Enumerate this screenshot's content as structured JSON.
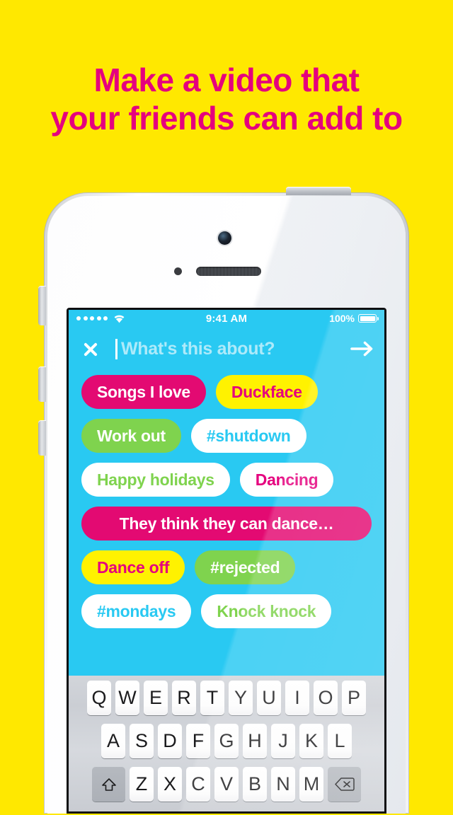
{
  "page": {
    "background_color": "#FFE800",
    "accent_pink": "#E5007E",
    "screen_cyan": "#29C9F2",
    "tag_green": "#7FD34E",
    "tag_yellow": "#FFF200"
  },
  "headline": {
    "line1": "Make a video that",
    "line2": "your friends can add to"
  },
  "phone": {
    "hardware": {
      "camera": "camera-icon",
      "proximity_sensor": "proximity-sensor-icon",
      "speaker": "earpiece-speaker",
      "power_button": "power-button",
      "mute_switch": "mute-switch",
      "volume_up": "volume-up-button",
      "volume_down": "volume-down-button"
    }
  },
  "status_bar": {
    "signal_dots": 5,
    "wifi": "wifi-icon",
    "time": "9:41 AM",
    "battery_percent": "100%",
    "battery_level": 100
  },
  "search": {
    "close_icon": "close-icon",
    "placeholder": "What's this about?",
    "value": "",
    "next_icon": "arrow-right-icon"
  },
  "tag_rows": [
    [
      {
        "label": "Songs I love",
        "bg": "#E30A72",
        "fg": "#FFFFFF"
      },
      {
        "label": "Duckface",
        "bg": "#FFF200",
        "fg": "#E5007E"
      }
    ],
    [
      {
        "label": "Work out",
        "bg": "#7FD34E",
        "fg": "#FFFFFF"
      },
      {
        "label": "#shutdown",
        "bg": "#FFFFFF",
        "fg": "#29C9F2"
      }
    ],
    [
      {
        "label": "Happy holidays",
        "bg": "#FFFFFF",
        "fg": "#7FD34E"
      },
      {
        "label": "Dancing",
        "bg": "#FFFFFF",
        "fg": "#E5007E"
      }
    ],
    [
      {
        "label": "They think they can dance…",
        "bg": "#E30A72",
        "fg": "#FFFFFF",
        "wide": true
      }
    ],
    [
      {
        "label": "Dance off",
        "bg": "#FFF200",
        "fg": "#E5007E"
      },
      {
        "label": "#rejected",
        "bg": "#7FD34E",
        "fg": "#FFFFFF"
      }
    ],
    [
      {
        "label": "#mondays",
        "bg": "#FFFFFF",
        "fg": "#29C9F2"
      },
      {
        "label": "Knock knock",
        "bg": "#FFFFFF",
        "fg": "#7FD34E"
      }
    ]
  ],
  "keyboard": {
    "row1": [
      "Q",
      "W",
      "E",
      "R",
      "T",
      "Y",
      "U",
      "I",
      "O",
      "P"
    ],
    "row2": [
      "A",
      "S",
      "D",
      "F",
      "G",
      "H",
      "J",
      "K",
      "L"
    ],
    "row3": [
      "Z",
      "X",
      "C",
      "V",
      "B",
      "N",
      "M"
    ],
    "shift_icon": "shift-icon",
    "delete_icon": "backspace-icon"
  }
}
